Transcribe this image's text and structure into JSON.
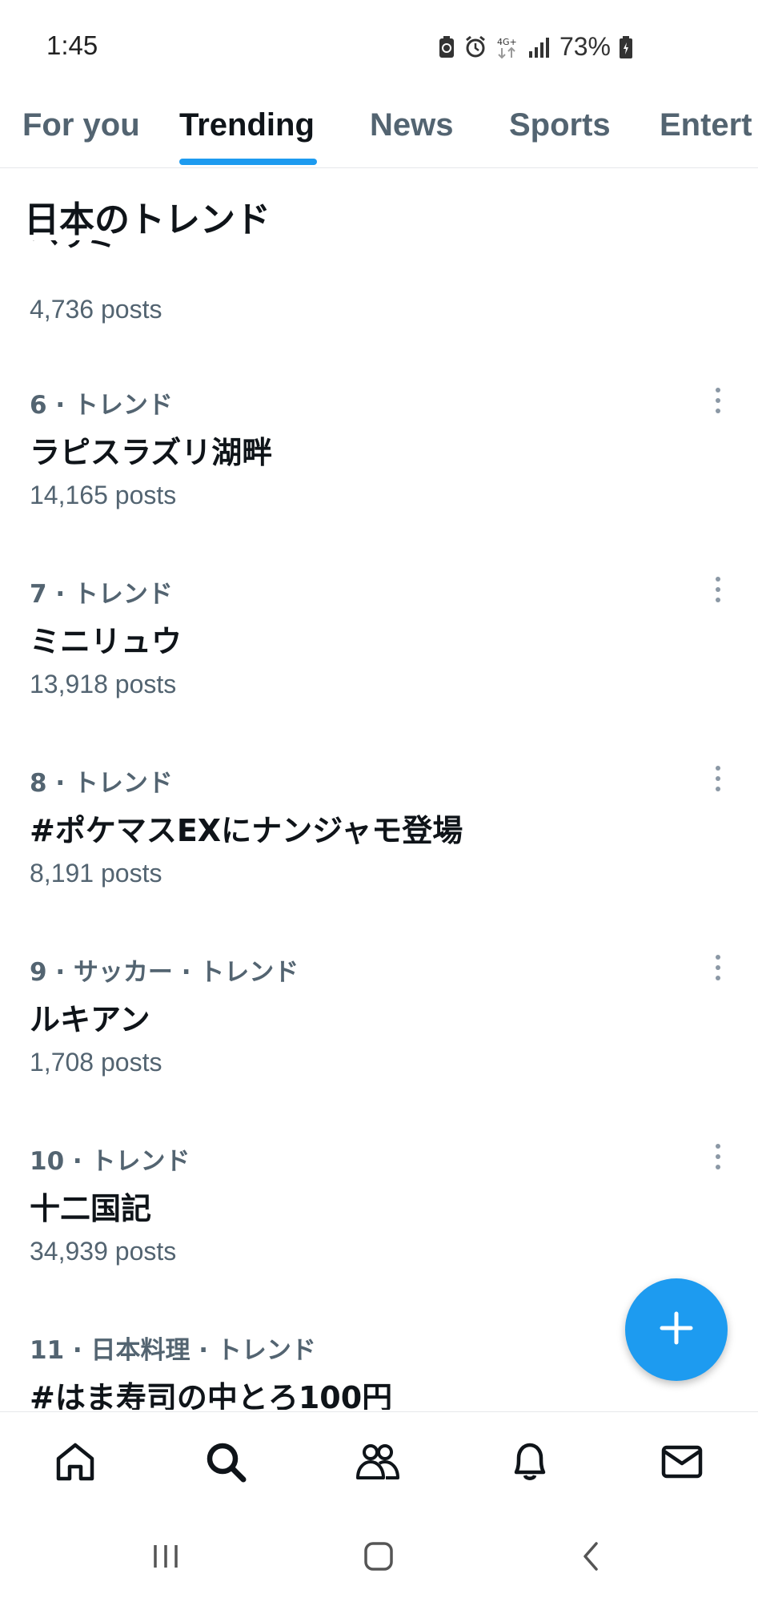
{
  "status_bar": {
    "time": "1:45",
    "network": "4G+",
    "battery": "73%"
  },
  "tabs": [
    {
      "label": "For you",
      "active": false
    },
    {
      "label": "Trending",
      "active": true
    },
    {
      "label": "News",
      "active": false
    },
    {
      "label": "Sports",
      "active": false
    },
    {
      "label": "Entert",
      "active": false
    }
  ],
  "section": {
    "title": "日本のトレンド"
  },
  "partial_trend": {
    "name": "ヘリミー",
    "count": "4,736 posts"
  },
  "trends": [
    {
      "meta": "6 · トレンド",
      "name": "ラピスラズリ湖畔",
      "count": "14,165 posts"
    },
    {
      "meta": "7 · トレンド",
      "name": "ミニリュウ",
      "count": "13,918 posts"
    },
    {
      "meta": "8 · トレンド",
      "name": "#ポケマスEXにナンジャモ登場",
      "count": "8,191 posts"
    },
    {
      "meta": "9 · サッカー · トレンド",
      "name": "ルキアン",
      "count": "1,708 posts"
    },
    {
      "meta": "10 · トレンド",
      "name": "十二国記",
      "count": "34,939 posts"
    },
    {
      "meta": "11 · 日本料理 · トレンド",
      "name": "#はま寿司の中とろ100円",
      "count": ""
    }
  ],
  "icons": {
    "compose": "plus-icon",
    "nav": [
      "home-icon",
      "search-icon",
      "communities-icon",
      "bell-icon",
      "mail-icon"
    ],
    "system": [
      "recents-icon",
      "home-button-icon",
      "back-icon"
    ]
  },
  "colors": {
    "accent": "#1d9bf0",
    "text_primary": "#0f1419",
    "text_secondary": "#536471"
  }
}
